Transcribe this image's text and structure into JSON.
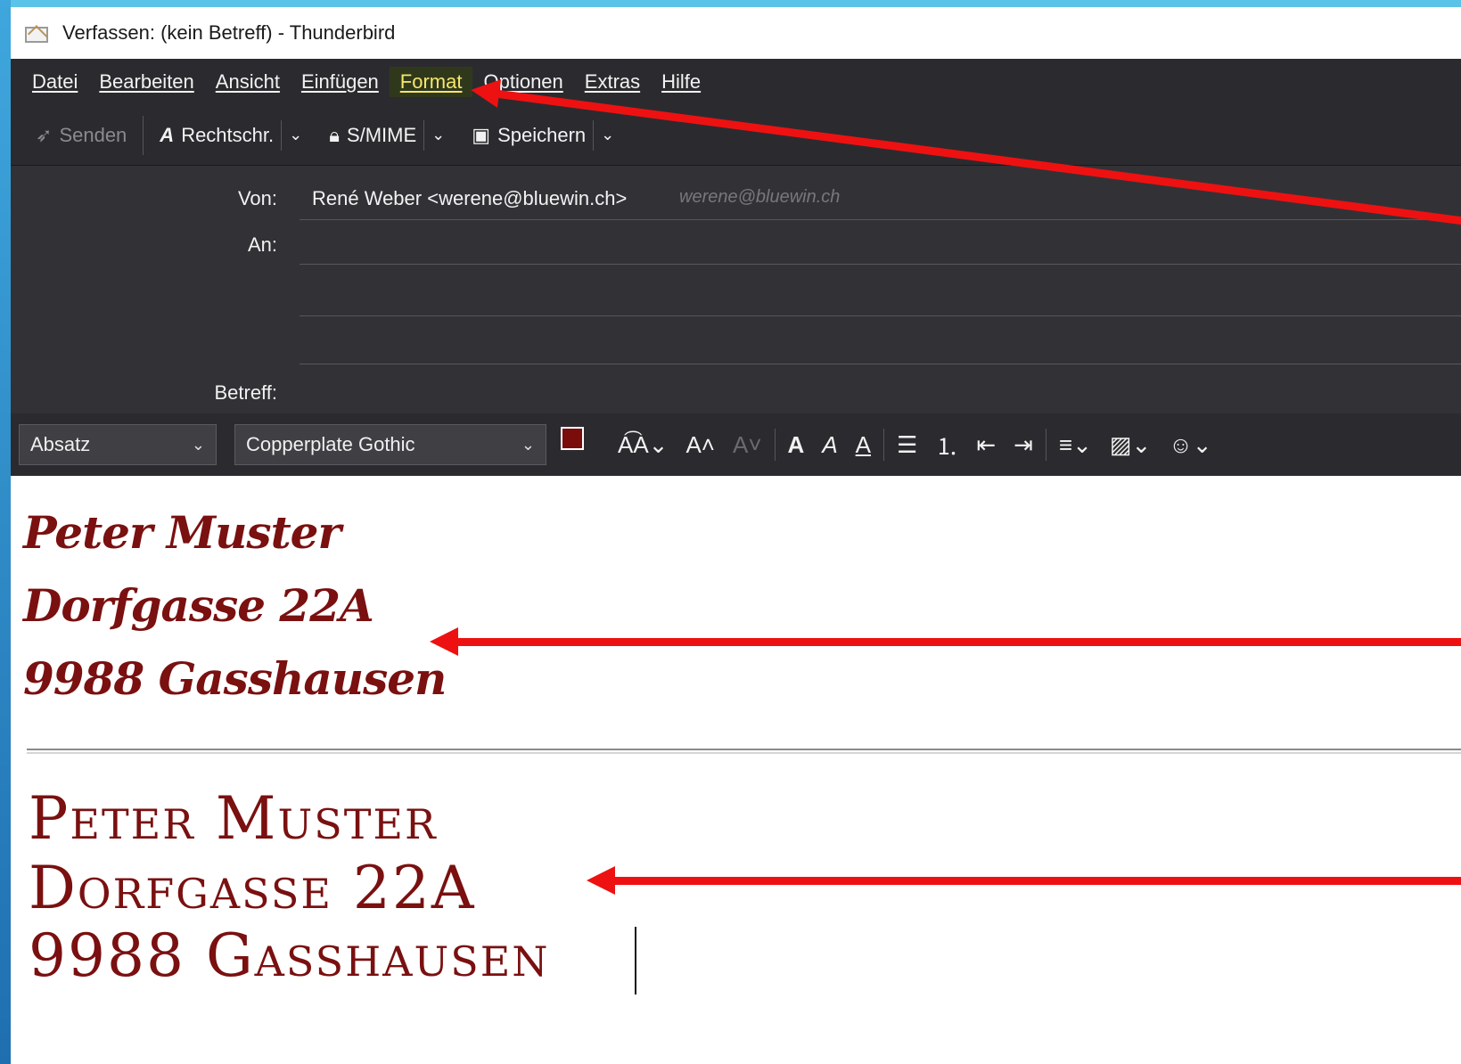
{
  "window": {
    "title": "Verfassen: (kein Betreff) - Thunderbird"
  },
  "menu": {
    "items": [
      "Datei",
      "Bearbeiten",
      "Ansicht",
      "Einfügen",
      "Format",
      "Optionen",
      "Extras",
      "Hilfe"
    ],
    "active": "Format"
  },
  "toolbar": {
    "send_label": "Senden",
    "spell_label": "Rechtschr.",
    "smime_label": "S/MIME",
    "save_label": "Speichern"
  },
  "headers": {
    "from_label": "Von:",
    "from_value": "René Weber <werene@bluewin.ch>",
    "from_hint": "werene@bluewin.ch",
    "to_label": "An:",
    "subject_label": "Betreff:"
  },
  "format_toolbar": {
    "paragraph_format": "Absatz",
    "font_family": "Copperplate Gothic",
    "text_color": "#7b0c0c"
  },
  "body": {
    "signature_script": [
      "Peter Muster",
      "Dorfgasse 22A",
      "9988 Gasshausen"
    ],
    "signature_caps": [
      "Peter Muster",
      "Dorfgasse 22A",
      "9988 Gasshausen"
    ]
  },
  "annotations": {
    "arrow_color": "#ee1111"
  }
}
